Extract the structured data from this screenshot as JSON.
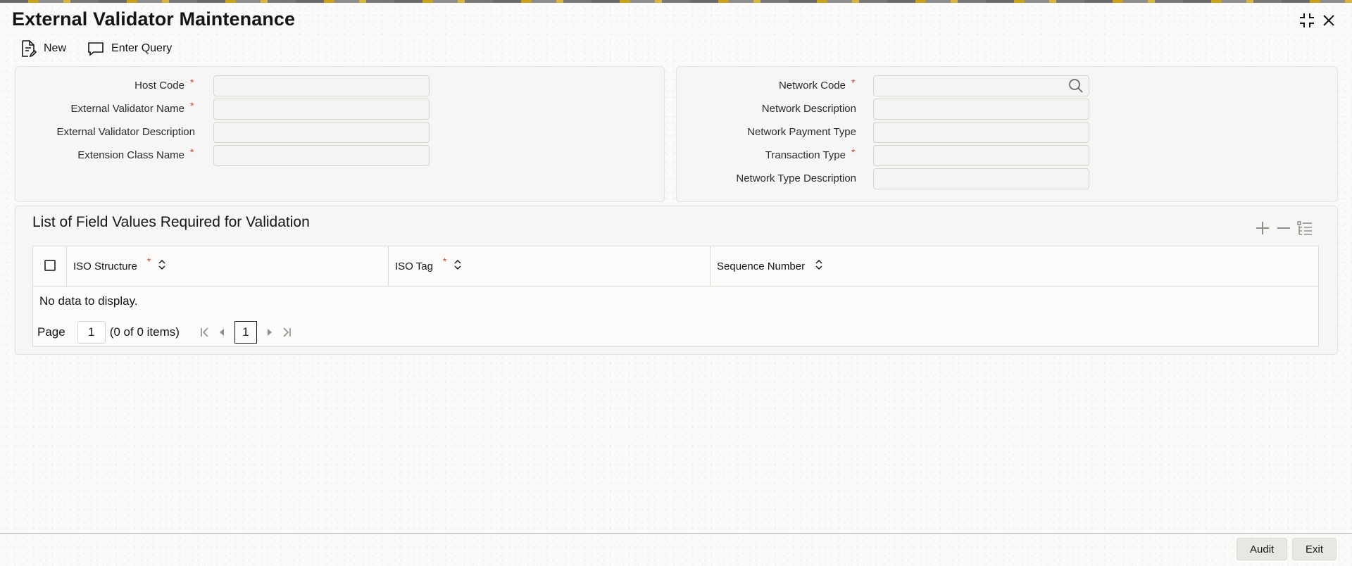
{
  "window": {
    "title": "External Validator Maintenance",
    "maximize_icon": "maximize-icon",
    "close_icon": "close-icon"
  },
  "toolbar": {
    "new_label": "New",
    "enter_query_label": "Enter Query"
  },
  "left_form": {
    "host_code": {
      "label": "Host Code",
      "required": true,
      "value": ""
    },
    "external_validator_name": {
      "label": "External Validator Name",
      "required": true,
      "value": ""
    },
    "external_validator_description": {
      "label": "External Validator Description",
      "required": false,
      "value": ""
    },
    "extension_class_name": {
      "label": "Extension Class Name",
      "required": true,
      "value": ""
    }
  },
  "right_form": {
    "network_code": {
      "label": "Network Code",
      "required": true,
      "value": ""
    },
    "network_description": {
      "label": "Network Description",
      "required": false,
      "value": ""
    },
    "network_payment_type": {
      "label": "Network Payment Type",
      "required": false,
      "value": ""
    },
    "transaction_type": {
      "label": "Transaction Type",
      "required": true,
      "value": ""
    },
    "network_type_description": {
      "label": "Network Type Description",
      "required": false,
      "value": ""
    }
  },
  "grid": {
    "title": "List of Field Values Required for Validation",
    "columns": [
      {
        "label": "ISO Structure",
        "required": true
      },
      {
        "label": "ISO Tag",
        "required": true
      },
      {
        "label": "Sequence Number",
        "required": false
      }
    ],
    "rows": [],
    "empty_text": "No data to display.",
    "pager": {
      "page_label": "Page",
      "page_value": "1",
      "items_text": "(0 of 0 items)",
      "current_page": "1"
    }
  },
  "required_marker": "*",
  "footer": {
    "audit_label": "Audit",
    "exit_label": "Exit"
  },
  "colors": {
    "required": "#c74634",
    "panel": "#f7f6f4",
    "text": "#161513"
  }
}
